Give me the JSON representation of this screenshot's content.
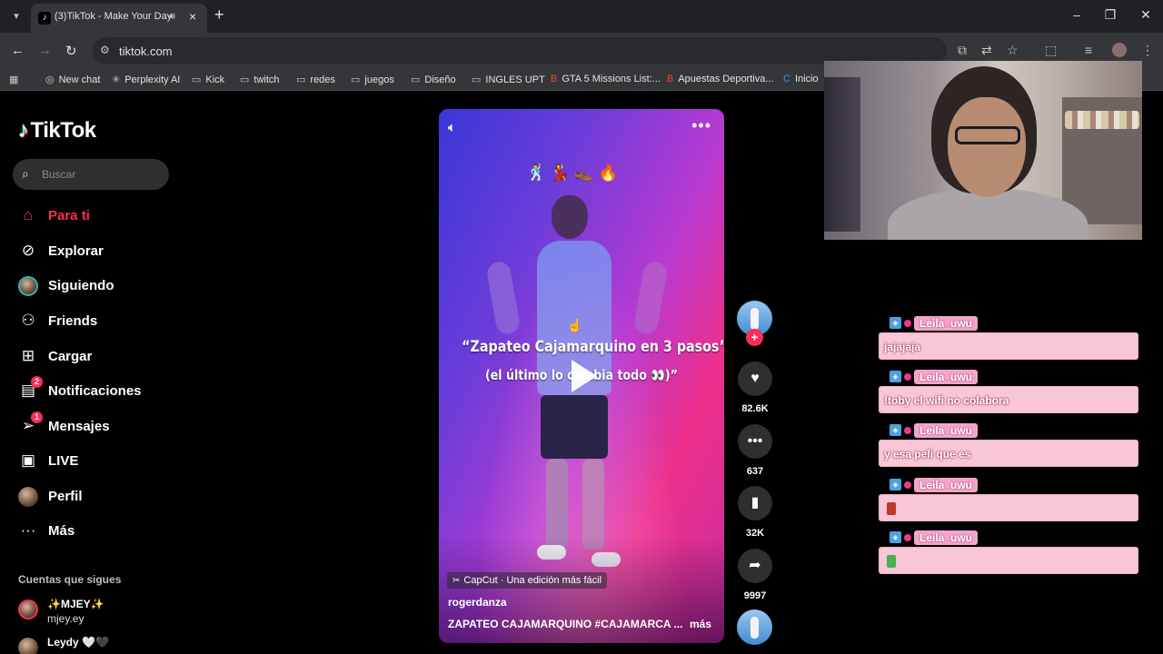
{
  "browser": {
    "tab_title": "(3)TikTok - Make Your Day",
    "url": "tiktok.com",
    "bookmarks": [
      "New chat",
      "Perplexity AI",
      "Kick",
      "twitch",
      "redes",
      "juegos",
      "Diseño",
      "INGLES UPT",
      "GTA 5 Missions List:...",
      "Apuestas Deportiva...",
      "Inicio"
    ]
  },
  "sidebar": {
    "logo": "TikTok",
    "search_placeholder": "Buscar",
    "nav": [
      {
        "label": "Para ti",
        "icon": "home-icon",
        "active": true
      },
      {
        "label": "Explorar",
        "icon": "compass-icon"
      },
      {
        "label": "Siguiendo",
        "icon": "following-avatar-icon"
      },
      {
        "label": "Friends",
        "icon": "friends-icon"
      },
      {
        "label": "Cargar",
        "icon": "upload-icon"
      },
      {
        "label": "Notificaciones",
        "icon": "inbox-icon",
        "badge": "2"
      },
      {
        "label": "Mensajes",
        "icon": "send-icon",
        "badge": "1"
      },
      {
        "label": "LIVE",
        "icon": "live-tv-icon"
      },
      {
        "label": "Perfil",
        "icon": "profile-avatar-icon"
      },
      {
        "label": "Más",
        "icon": "more-dots-icon"
      }
    ],
    "following_title": "Cuentas que sigues",
    "following": [
      {
        "name": "✨MJEY✨",
        "handle": "mjey.ey"
      },
      {
        "name": "Leydy 🤍🖤",
        "handle": ""
      }
    ]
  },
  "video": {
    "caption_line1": "“Zapateo Cajamarquino en 3 pasos”",
    "caption_line2": "(el último lo cambia todo 👀)”",
    "emojis": "🕺💃👞🔥",
    "capcut_label": "CapCut · Una edición más fácil",
    "author": "rogerdanza",
    "description": "ZAPATEO CAJAMARQUINO  #CAJAMARCA  ...",
    "more_label": "más"
  },
  "actions": {
    "likes": "82.6K",
    "comments": "637",
    "saves": "32K",
    "shares": "9997"
  },
  "chat": [
    {
      "user": "Leila_uwu",
      "text": "jajajaja"
    },
    {
      "user": "Leila_uwu",
      "text": "!toby el wifi no colabora"
    },
    {
      "user": "Leila_uwu",
      "text": "y esa peli que es"
    },
    {
      "user": "Leila_uwu",
      "text": "",
      "emote_color": "#c0392b"
    },
    {
      "user": "Leila_uwu",
      "text": "",
      "emote_color": "#4caf50"
    }
  ],
  "colors": {
    "accent": "#fe2c55",
    "chat_bubble": "#f8c6d6"
  }
}
